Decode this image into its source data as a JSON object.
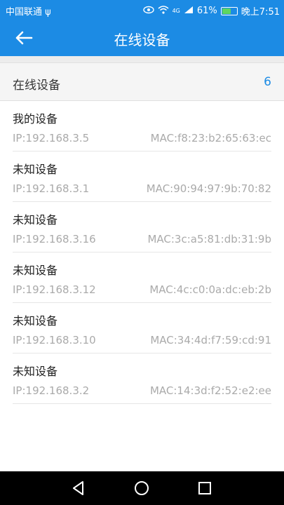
{
  "status_bar": {
    "carrier": "中国联通",
    "usb_icon": "usb-icon",
    "network": "4G",
    "battery_percent": "61%",
    "time": "晚上7:51",
    "battery_level": 0.61
  },
  "app_bar": {
    "title": "在线设备",
    "back_icon": "back-arrow-icon"
  },
  "summary": {
    "label": "在线设备",
    "count": "6"
  },
  "devices": [
    {
      "name": "我的设备",
      "ip": "IP:192.168.3.5",
      "mac": "MAC:f8:23:b2:65:63:ec"
    },
    {
      "name": "未知设备",
      "ip": "IP:192.168.3.1",
      "mac": "MAC:90:94:97:9b:70:82"
    },
    {
      "name": "未知设备",
      "ip": "IP:192.168.3.16",
      "mac": "MAC:3c:a5:81:db:31:9b"
    },
    {
      "name": "未知设备",
      "ip": "IP:192.168.3.12",
      "mac": "MAC:4c:c0:0a:dc:eb:2b"
    },
    {
      "name": "未知设备",
      "ip": "IP:192.168.3.10",
      "mac": "MAC:34:4d:f7:59:cd:91"
    },
    {
      "name": "未知设备",
      "ip": "IP:192.168.3.2",
      "mac": "MAC:14:3d:f2:52:e2:ee"
    }
  ],
  "colors": {
    "primary": "#1c8be4",
    "secondary_text": "#aaaaaa",
    "divider": "#e6e6e6"
  }
}
